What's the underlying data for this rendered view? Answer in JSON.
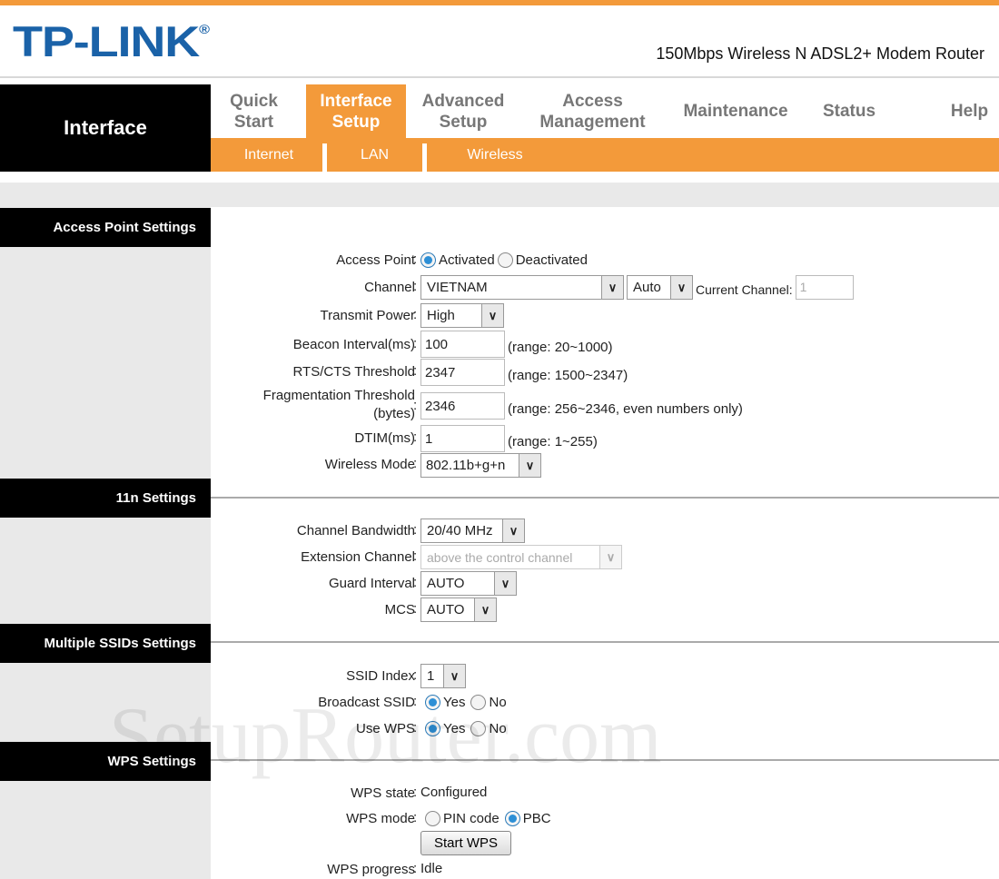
{
  "header": {
    "logo": "TP-LINK",
    "logo_mark": "®",
    "subtitle": "150Mbps Wireless N ADSL2+ Modem Router",
    "section": "Interface"
  },
  "nav": {
    "tabs": [
      "Quick Start",
      "Interface Setup",
      "Advanced Setup",
      "Access Management",
      "Maintenance",
      "Status",
      "Help"
    ],
    "active": "Interface Setup",
    "subtabs": [
      "Internet",
      "LAN",
      "Wireless"
    ]
  },
  "sections": {
    "ap": "Access Point Settings",
    "n11": "11n Settings",
    "mssid": "Multiple SSIDs Settings",
    "wps": "WPS Settings"
  },
  "ap": {
    "access_point": {
      "label": "Access Point",
      "opt1": "Activated",
      "opt2": "Deactivated",
      "selected": "Activated"
    },
    "channel": {
      "label": "Channel",
      "country": "VIETNAM",
      "channel": "Auto",
      "current_label": "Current Channel:",
      "current_value": "1"
    },
    "transmit_power": {
      "label": "Transmit Power",
      "value": "High"
    },
    "beacon": {
      "label": "Beacon Interval(ms)",
      "value": "100",
      "range": "(range: 20~1000)"
    },
    "rts": {
      "label": "RTS/CTS Threshold",
      "value": "2347",
      "range": "(range: 1500~2347)"
    },
    "frag": {
      "label1": "Fragmentation Threshold",
      "label2": "(bytes)",
      "value": "2346",
      "range": "(range: 256~2346, even numbers only)"
    },
    "dtim": {
      "label": "DTIM(ms)",
      "value": "1",
      "range": "(range: 1~255)"
    },
    "mode": {
      "label": "Wireless Mode",
      "value": "802.11b+g+n"
    }
  },
  "n11": {
    "bandwidth": {
      "label": "Channel Bandwidth",
      "value": "20/40 MHz"
    },
    "extension": {
      "label": "Extension Channel",
      "value": "above the control channel"
    },
    "guard": {
      "label": "Guard Interval",
      "value": "AUTO"
    },
    "mcs": {
      "label": "MCS",
      "value": "AUTO"
    }
  },
  "mssid": {
    "index": {
      "label": "SSID Index",
      "value": "1"
    },
    "broadcast": {
      "label": "Broadcast SSID",
      "yes": "Yes",
      "no": "No",
      "selected": "Yes"
    },
    "usewps": {
      "label": "Use WPS",
      "yes": "Yes",
      "no": "No",
      "selected": "Yes"
    }
  },
  "wps": {
    "state": {
      "label": "WPS state",
      "value": "Configured"
    },
    "mode": {
      "label": "WPS mode",
      "opt1": "PIN code",
      "opt2": "PBC",
      "selected": "PBC"
    },
    "start": "Start WPS",
    "progress": {
      "label": "WPS progress",
      "value": "Idle"
    }
  },
  "watermark": "SetupRouter.com"
}
